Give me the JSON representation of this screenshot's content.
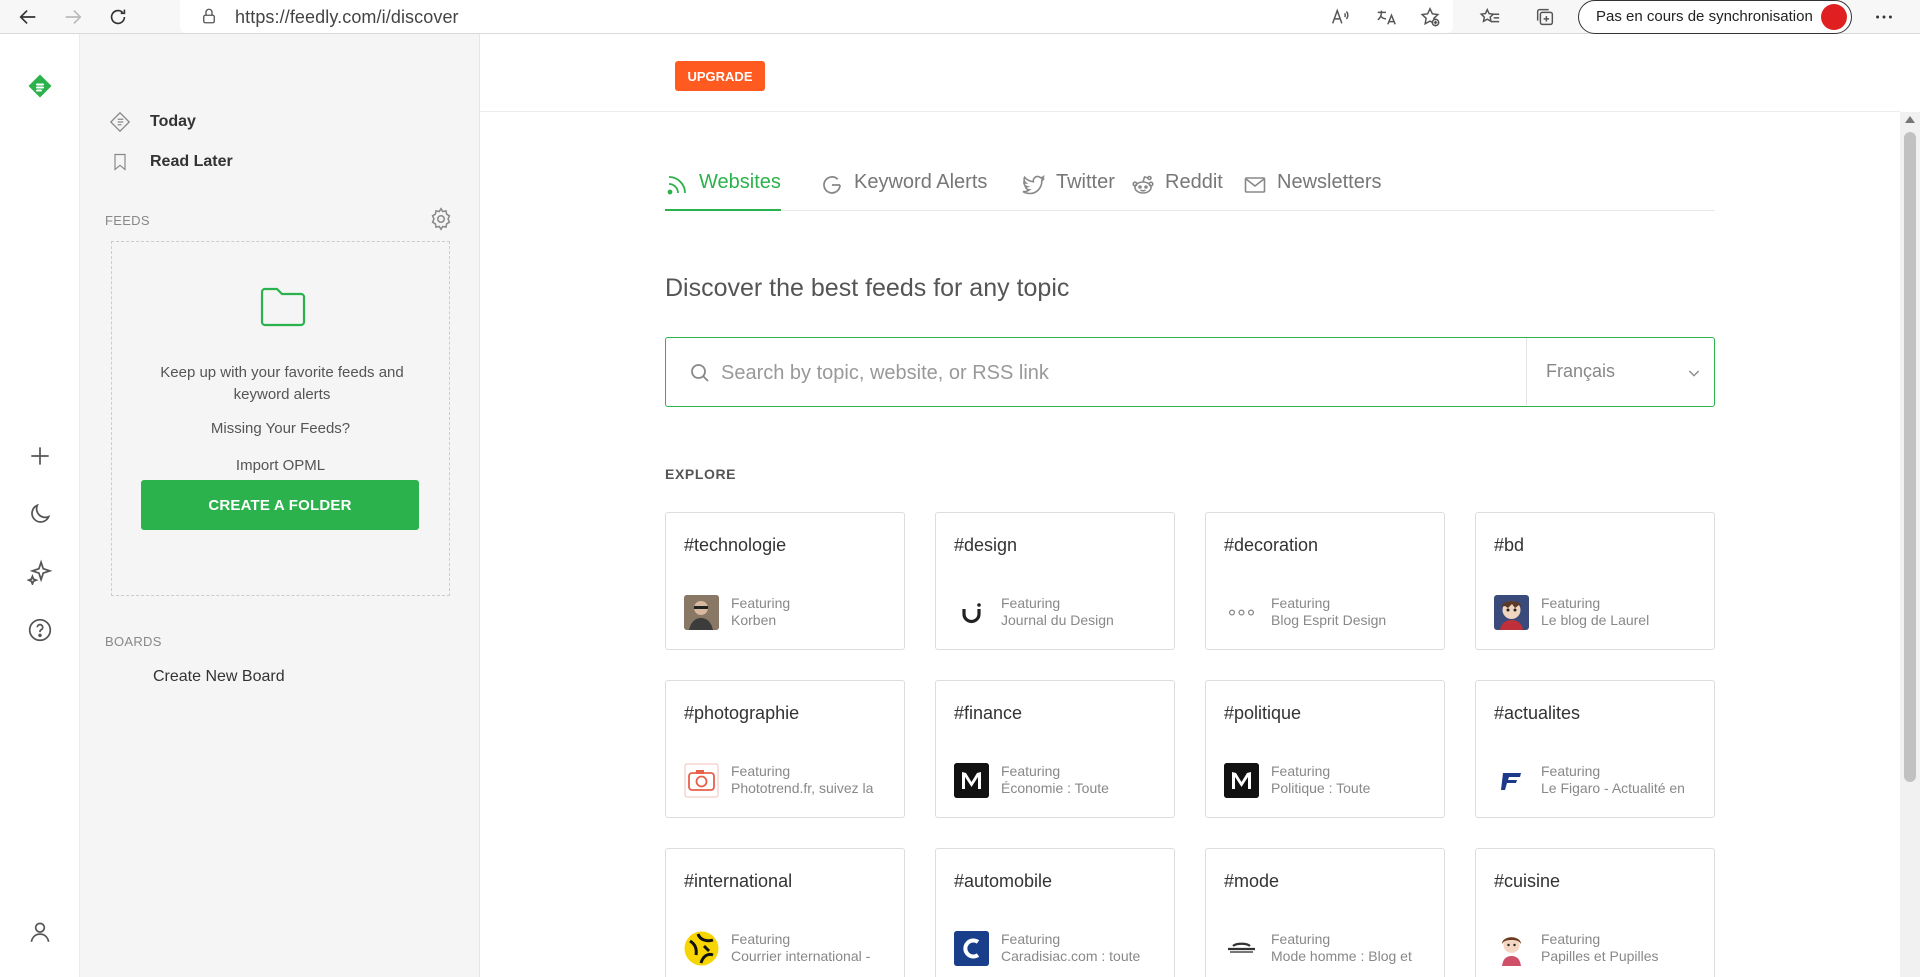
{
  "browser": {
    "url": "https://feedly.com/i/discover",
    "sync_label": "Pas en cours de synchronisation"
  },
  "rail": {
    "icons": [
      "feedly-logo-icon",
      "add-icon",
      "moon-icon",
      "sparkle-icon",
      "help-icon",
      "user-icon"
    ]
  },
  "sidebar": {
    "today": "Today",
    "read_later": "Read Later",
    "feeds_label": "FEEDS",
    "empty_text": "Keep up with your favorite feeds and keyword alerts",
    "create_folder": "CREATE A FOLDER",
    "missing_feeds": "Missing Your Feeds?",
    "import_opml": "Import OPML",
    "boards_label": "BOARDS",
    "create_board": "Create New Board"
  },
  "header": {
    "upgrade": "UPGRADE"
  },
  "tabs": [
    {
      "label": "Websites",
      "icon": "rss-icon",
      "active": true
    },
    {
      "label": "Keyword Alerts",
      "icon": "google-icon",
      "active": false
    },
    {
      "label": "Twitter",
      "icon": "twitter-icon",
      "active": false
    },
    {
      "label": "Reddit",
      "icon": "reddit-icon",
      "active": false
    },
    {
      "label": "Newsletters",
      "icon": "mail-icon",
      "active": false
    }
  ],
  "discover": {
    "heading": "Discover the best feeds for any topic",
    "search_placeholder": "Search by topic, website, or RSS link",
    "language": "Français",
    "explore_label": "EXPLORE"
  },
  "cards": [
    {
      "tag": "#technologie",
      "featuring": "Featuring",
      "source": "Korben"
    },
    {
      "tag": "#design",
      "featuring": "Featuring",
      "source": "Journal du Design"
    },
    {
      "tag": "#decoration",
      "featuring": "Featuring",
      "source": "Blog Esprit Design"
    },
    {
      "tag": "#bd",
      "featuring": "Featuring",
      "source": "Le blog de Laurel"
    },
    {
      "tag": "#photographie",
      "featuring": "Featuring",
      "source": "Phototrend.fr, suivez la"
    },
    {
      "tag": "#finance",
      "featuring": "Featuring",
      "source": "Économie : Toute"
    },
    {
      "tag": "#politique",
      "featuring": "Featuring",
      "source": "Politique : Toute"
    },
    {
      "tag": "#actualites",
      "featuring": "Featuring",
      "source": "Le Figaro - Actualité en"
    },
    {
      "tag": "#international",
      "featuring": "Featuring",
      "source": "Courrier international -"
    },
    {
      "tag": "#automobile",
      "featuring": "Featuring",
      "source": "Caradisiac.com : toute"
    },
    {
      "tag": "#mode",
      "featuring": "Featuring",
      "source": "Mode homme : Blog et"
    },
    {
      "tag": "#cuisine",
      "featuring": "Featuring",
      "source": "Papilles et Pupilles"
    }
  ],
  "colors": {
    "accent": "#2bb24c",
    "upgrade": "#ff5a1f"
  }
}
